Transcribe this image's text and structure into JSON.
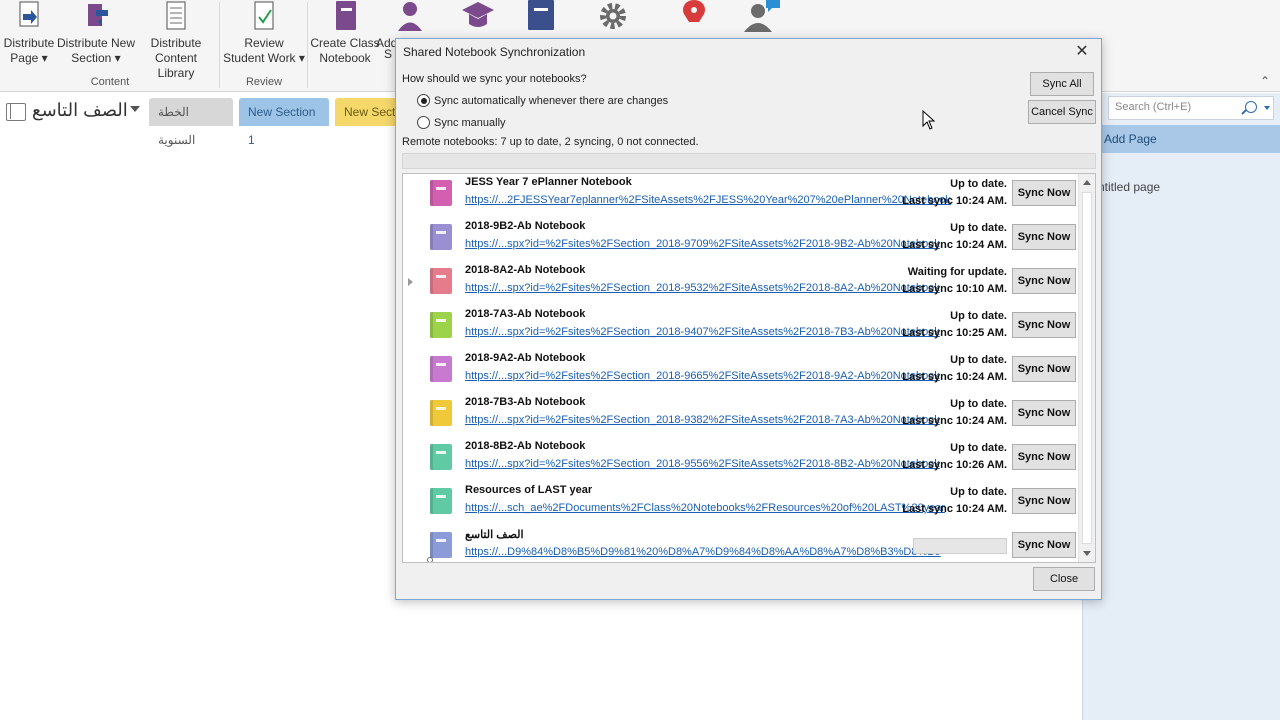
{
  "ribbon": {
    "buttons": [
      {
        "label": "Distribute Page ▾",
        "icon": "distribute-page-icon"
      },
      {
        "label": "Distribute New Section ▾",
        "icon": "distribute-section-icon"
      },
      {
        "label": "Distribute Content Library",
        "icon": "content-library-icon"
      },
      {
        "label": "Review Student Work ▾",
        "icon": "review-student-work-icon"
      },
      {
        "label": "Create Class Notebook",
        "icon": "class-notebook-icon"
      },
      {
        "label": "Add",
        "icon": "add-student-icon"
      },
      {
        "label": "S",
        "icon": "s-icon"
      }
    ],
    "groups": {
      "content": "Content",
      "review": "Review"
    },
    "colors": {
      "purple": "#7b4a8c",
      "gray": "#6b6b6b",
      "red": "#d83b3b",
      "blue": "#2b579a"
    }
  },
  "notebook": {
    "name": "الصف التاسع"
  },
  "section_tabs": [
    "الخطة السنوية",
    "New Section 1",
    "New Secti"
  ],
  "right_pane": {
    "search_placeholder": "Search (Ctrl+E)",
    "add_page": "Add Page",
    "page_title": "ntitled page"
  },
  "dialog": {
    "title": "Shared Notebook Synchronization",
    "close_symbol": "✕",
    "question": "How should we sync your notebooks?",
    "options": [
      {
        "label": "Sync automatically whenever there are changes",
        "selected": true
      },
      {
        "label": "Sync manually",
        "selected": false
      }
    ],
    "sync_all": "Sync All",
    "cancel_sync": "Cancel Sync",
    "status": "Remote notebooks: 7 up to date, 2 syncing, 0 not connected.",
    "overall_progress": 0.0,
    "rows": [
      {
        "name": "JESS Year 7 ePlanner Notebook",
        "url": "https://...2FJESSYear7eplanner%2FSiteAssets%2FJESS%20Year%207%20ePlanner%20Notebook",
        "status": "Up to date.",
        "last_sync": "Last sync 10:24 AM.",
        "color": "#d35fb0",
        "button": "Sync Now"
      },
      {
        "name": "2018-9B2-Ab Notebook",
        "url": "https://...spx?id=%2Fsites%2FSection_2018-9709%2FSiteAssets%2F2018-9B2-Ab%20Notebook",
        "status": "Up to date.",
        "last_sync": "Last sync 10:24 AM.",
        "color": "#9b8fd4",
        "button": "Sync Now"
      },
      {
        "name": "2018-8A2-Ab Notebook",
        "url": "https://...spx?id=%2Fsites%2FSection_2018-9532%2FSiteAssets%2F2018-8A2-Ab%20Notebook",
        "status": "Waiting for update.",
        "last_sync": "Last sync 10:10 AM.",
        "color": "#e57c8c",
        "button": "Sync Now"
      },
      {
        "name": "2018-7A3-Ab Notebook",
        "url": "https://...spx?id=%2Fsites%2FSection_2018-9407%2FSiteAssets%2F2018-7B3-Ab%20Notebook",
        "status": "Up to date.",
        "last_sync": "Last sync 10:25 AM.",
        "color": "#9cd34a",
        "button": "Sync Now"
      },
      {
        "name": "2018-9A2-Ab Notebook",
        "url": "https://...spx?id=%2Fsites%2FSection_2018-9665%2FSiteAssets%2F2018-9A2-Ab%20Notebook",
        "status": "Up to date.",
        "last_sync": "Last sync 10:24 AM.",
        "color": "#c77ad0",
        "button": "Sync Now"
      },
      {
        "name": "2018-7B3-Ab Notebook",
        "url": "https://...spx?id=%2Fsites%2FSection_2018-9382%2FSiteAssets%2F2018-7A3-Ab%20Notebook",
        "status": "Up to date.",
        "last_sync": "Last sync 10:24 AM.",
        "color": "#f0c93a",
        "button": "Sync Now"
      },
      {
        "name": "2018-8B2-Ab Notebook",
        "url": "https://...spx?id=%2Fsites%2FSection_2018-9556%2FSiteAssets%2F2018-8B2-Ab%20Notebook",
        "status": "Up to date.",
        "last_sync": "Last sync 10:26 AM.",
        "color": "#5fcaa3",
        "button": "Sync Now"
      },
      {
        "name": "Resources of LAST year",
        "url": "https://...sch_ae%2FDocuments%2FClass%20Notebooks%2FResources%20of%20LAST%20year",
        "status": "Up to date.",
        "last_sync": "Last sync 10:24 AM.",
        "color": "#5fcaa3",
        "button": "Sync Now"
      },
      {
        "name": "الصف التاسع",
        "url": "https://...D9%84%D8%B5%D9%81%20%D8%A7%D9%84%D8%AA%D8%A7%D8%B3%D8%B9",
        "status": "",
        "last_sync": "",
        "color": "#8a9bd8",
        "button": "Sync Now",
        "progress": 0.0
      }
    ],
    "close": "Close"
  }
}
